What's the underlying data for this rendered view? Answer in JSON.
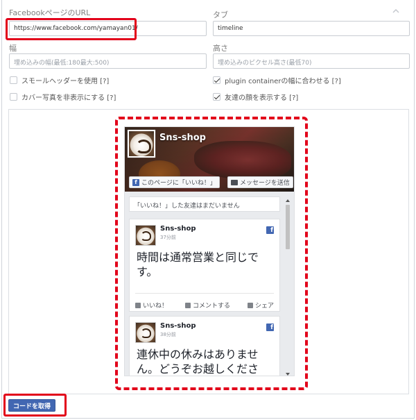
{
  "form": {
    "url_label": "FacebookページのURL",
    "url_value": "https://www.facebook.com/yamayan01/",
    "tabs_label": "タブ",
    "tabs_value": "timeline",
    "width_label": "幅",
    "width_placeholder": "埋め込みの幅(最低:180最大:500)",
    "height_label": "高さ",
    "height_placeholder": "埋め込みのピクセル高さ(最低70)",
    "small_header_label": "スモールヘッダーを使用 [?]",
    "small_header_checked": false,
    "adapt_width_label": "plugin containerの幅に合わせる [?]",
    "adapt_width_checked": true,
    "hide_cover_label": "カバー写真を非表示にする [?]",
    "hide_cover_checked": false,
    "show_faces_label": "友達の顔を表示する [?]",
    "show_faces_checked": true
  },
  "preview": {
    "page_name": "Sns-shop",
    "like_button": "このページに「いいね！」",
    "message_button": "メッセージを送信",
    "friends_text": "「いいね！」した友達はまだいません",
    "posts": [
      {
        "name": "Sns-shop",
        "time": "37分前",
        "body": "時間は通常営業と同じです。",
        "actions": [
          "いいね！",
          "コメントする",
          "シェア"
        ]
      },
      {
        "name": "Sns-shop",
        "time": "38分前",
        "body": "連休中の休みはありません。どうぞお越しくださ"
      }
    ]
  },
  "get_code_button": "コードを取得",
  "colors": {
    "highlight": "#e2001a",
    "facebook_blue": "#4267b2"
  },
  "icons": [
    "chevron-up-icon",
    "facebook-icon",
    "message-icon",
    "like-icon",
    "comment-icon",
    "share-icon"
  ]
}
